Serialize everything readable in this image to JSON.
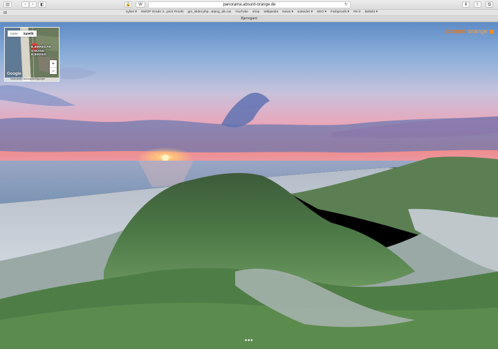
{
  "browser": {
    "url": "panorama.absurd-orange.de",
    "reload_icon": "reload-icon",
    "bookmarks": [
      "sylies ▾",
      "SWOP Grade 3...print Proofs",
      "gm_slider.php...&lang_alt=1&",
      "YouTube",
      "shop",
      "Wikipedia",
      "News ▾",
      "solander ▾",
      "SEO ▾",
      "Farbproofs ▾",
      "Pin it",
      "Beliebt ▾"
    ],
    "tab_title": "Bjerregard"
  },
  "brand": {
    "part1": "absurd",
    "part2": "orange",
    "accent": "#f18a2a"
  },
  "map": {
    "tab_map": "Karte",
    "tab_satellite": "Satellit",
    "place_label_1": "BJERREGAR",
    "place_label_2": "STRAND",
    "place_label_3": "BJERREG",
    "zoom_in": "+",
    "zoom_out": "−",
    "google_logo": "Google",
    "footer": "Kartendaten  Nutzungsbedingungen"
  },
  "viewer": {
    "more_dots": "•••"
  }
}
